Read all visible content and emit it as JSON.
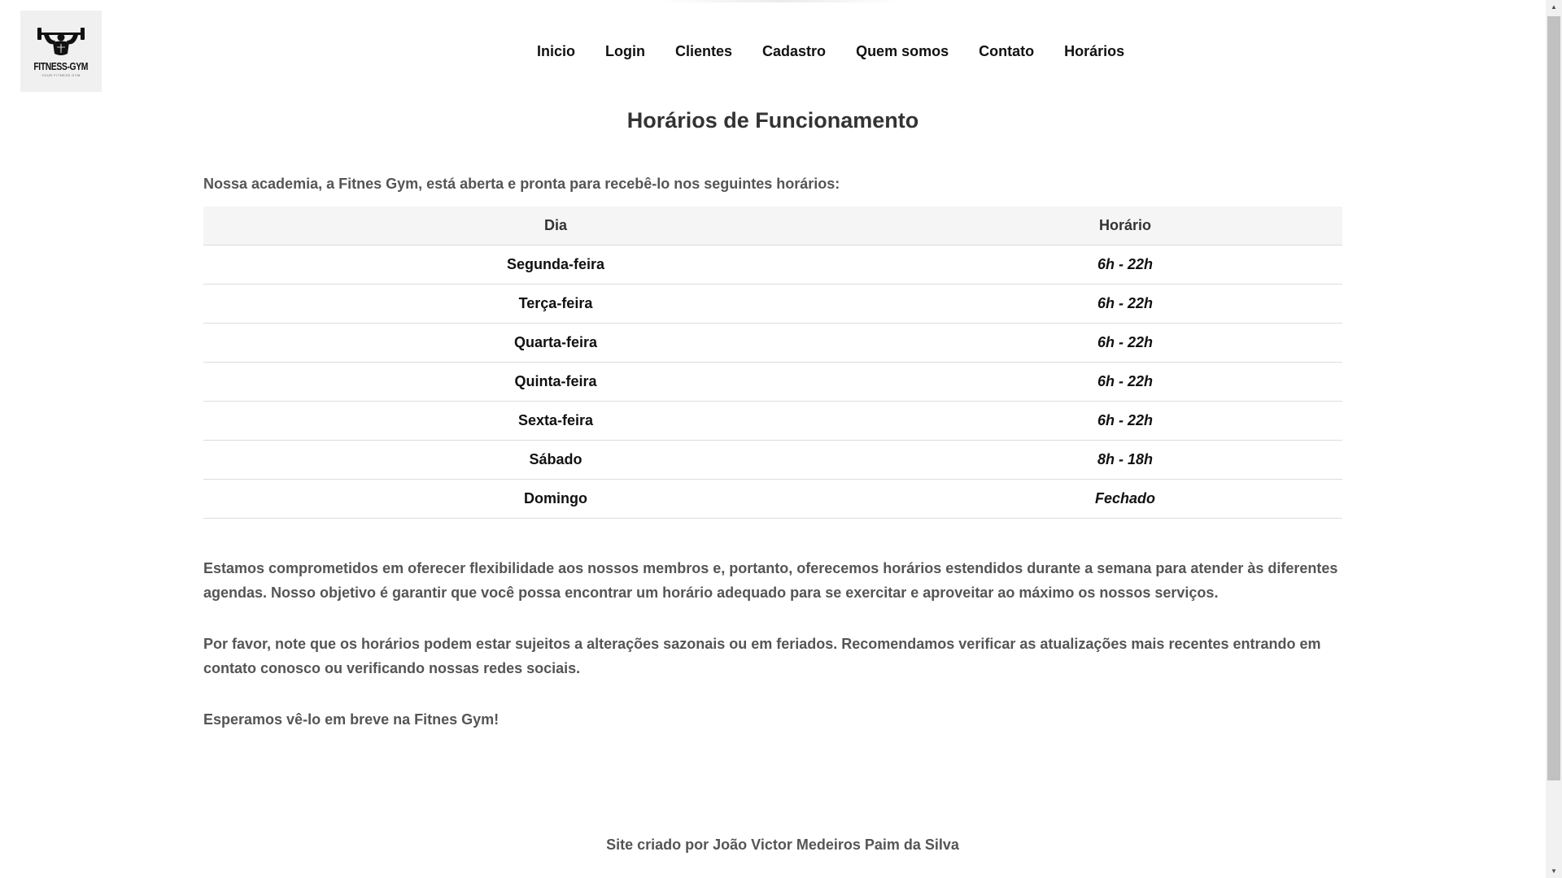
{
  "logo": {
    "title": "FITNESS-GYM",
    "tagline": "YOUR FITNESS GYM"
  },
  "nav": {
    "items": [
      {
        "label": "Inicio"
      },
      {
        "label": "Login"
      },
      {
        "label": "Clientes"
      },
      {
        "label": "Cadastro"
      },
      {
        "label": "Quem somos"
      },
      {
        "label": "Contato"
      },
      {
        "label": "Horários"
      }
    ]
  },
  "main": {
    "title": "Horários de Funcionamento",
    "intro": "Nossa academia, a Fitnes Gym, está aberta e pronta para recebê-lo nos seguintes horários:",
    "table": {
      "headers": [
        "Dia",
        "Horário"
      ],
      "rows": [
        {
          "day": "Segunda-feira",
          "time": "6h - 22h"
        },
        {
          "day": "Terça-feira",
          "time": "6h - 22h"
        },
        {
          "day": "Quarta-feira",
          "time": "6h - 22h"
        },
        {
          "day": "Quinta-feira",
          "time": "6h - 22h"
        },
        {
          "day": "Sexta-feira",
          "time": "6h - 22h"
        },
        {
          "day": "Sábado",
          "time": "8h - 18h"
        },
        {
          "day": "Domingo",
          "time": "Fechado"
        }
      ]
    },
    "paragraphs": [
      "Estamos comprometidos em oferecer flexibilidade aos nossos membros e, portanto, oferecemos horários estendidos durante a semana para atender às diferentes agendas. Nosso objetivo é garantir que você possa encontrar um horário adequado para se exercitar e aproveitar ao máximo os nossos serviços.",
      "Por favor, note que os horários podem estar sujeitos a alterações sazonais ou em feriados. Recomendamos verificar as atualizações mais recentes entrando em contato conosco ou verificando nossas redes sociais.",
      "Esperamos vê-lo em breve na Fitnes Gym!"
    ]
  },
  "footer": {
    "credit": "Site criado por João Victor Medeiros Paim da Silva"
  },
  "icons": {
    "logo": "bodybuilder-icon",
    "scroll_up": "arrow-up-icon",
    "scroll_down": "arrow-down-icon"
  }
}
